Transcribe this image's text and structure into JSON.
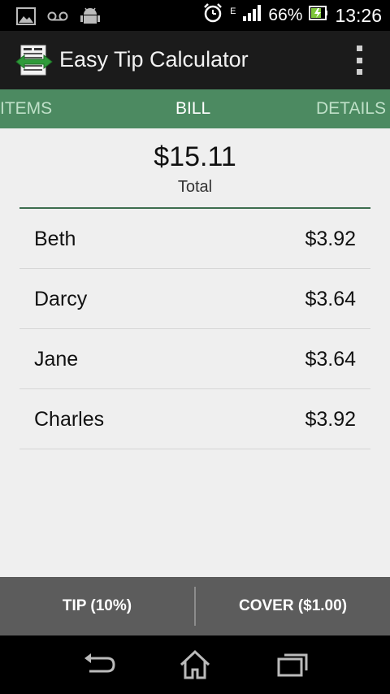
{
  "status_bar": {
    "battery": "66%",
    "time": "13:26",
    "network": "E",
    "icons": [
      "gallery-icon",
      "voicemail-icon",
      "android-icon",
      "alarm-icon",
      "signal-icon",
      "battery-charging-icon"
    ]
  },
  "action_bar": {
    "title": "Easy Tip Calculator",
    "icons": [
      "app-logo-icon",
      "overflow-menu-icon"
    ]
  },
  "tabs": [
    {
      "label": "ITEMS",
      "active": false
    },
    {
      "label": "BILL",
      "active": true
    },
    {
      "label": "DETAILS",
      "active": false
    }
  ],
  "bill": {
    "total_amount": "$15.11",
    "total_label": "Total",
    "people": [
      {
        "name": "Beth",
        "amount": "$3.92"
      },
      {
        "name": "Darcy",
        "amount": "$3.64"
      },
      {
        "name": "Jane",
        "amount": "$3.64"
      },
      {
        "name": "Charles",
        "amount": "$3.92"
      }
    ]
  },
  "bottom_bar": {
    "tip_label": "TIP (10%)",
    "cover_label": "COVER ($1.00)"
  },
  "nav_bar": {
    "icons": [
      "back-icon",
      "home-icon",
      "recent-apps-icon"
    ]
  },
  "colors": {
    "tab_bar": "#4c8a61",
    "action_bar": "#1b1b1b",
    "content_bg": "#efefef",
    "bottom_bar": "#5c5c5c",
    "accent_divider": "#3e6e4f"
  }
}
